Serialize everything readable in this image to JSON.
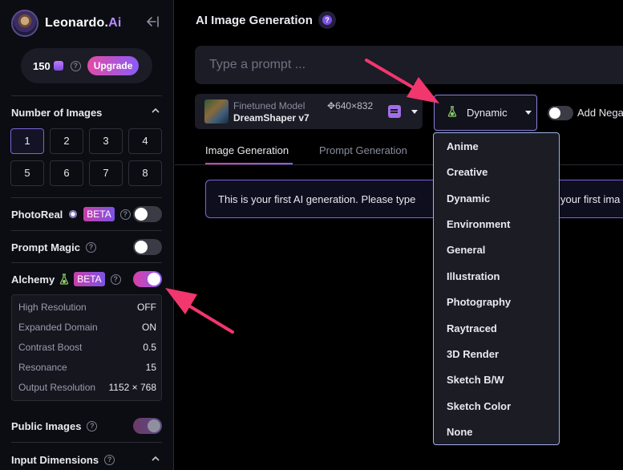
{
  "brand": {
    "name_prefix": "Leonardo.",
    "name_suffix": "Ai"
  },
  "credits": {
    "amount": "150",
    "upgrade_label": "Upgrade"
  },
  "number_of_images": {
    "title": "Number of Images",
    "options": [
      "1",
      "2",
      "3",
      "4",
      "5",
      "6",
      "7",
      "8"
    ],
    "selected": "1"
  },
  "photoreal": {
    "label": "PhotoReal",
    "badge": "BETA",
    "enabled": false
  },
  "prompt_magic": {
    "label": "Prompt Magic",
    "enabled": false
  },
  "alchemy": {
    "label": "Alchemy",
    "badge": "BETA",
    "enabled": true,
    "settings": [
      {
        "label": "High Resolution",
        "value": "OFF"
      },
      {
        "label": "Expanded Domain",
        "value": "ON"
      },
      {
        "label": "Contrast Boost",
        "value": "0.5"
      },
      {
        "label": "Resonance",
        "value": "15"
      },
      {
        "label": "Output Resolution",
        "value": "1152 × 768"
      }
    ]
  },
  "public_images": {
    "label": "Public Images",
    "enabled": true
  },
  "input_dimensions": {
    "label": "Input Dimensions"
  },
  "main": {
    "title": "AI Image Generation",
    "prompt_placeholder": "Type a prompt ...",
    "model": {
      "subtitle": "Finetuned Model",
      "name": "DreamShaper v7",
      "dimensions": "640×832"
    },
    "style": {
      "selected": "Dynamic"
    },
    "negative_prompt_label": "Add Nega",
    "tabs": [
      "Image Generation",
      "Prompt Generation"
    ],
    "notice_start": "This is your first AI generation. Please type",
    "notice_end": "your first ima"
  },
  "style_options": [
    "Anime",
    "Creative",
    "Dynamic",
    "Environment",
    "General",
    "Illustration",
    "Photography",
    "Raytraced",
    "3D Render",
    "Sketch B/W",
    "Sketch Color",
    "None"
  ],
  "colors": {
    "accent_pink": "#e24ba6",
    "accent_purple": "#8a5cf6",
    "arrow": "#f2366e",
    "background": "#000000",
    "sidebar": "#0c0d12"
  },
  "icons": [
    "collapse-sidebar-icon",
    "coin-icon",
    "help-icon",
    "chevron-up-icon",
    "photoreal-icon",
    "alchemy-flask-icon",
    "prompt-help-icon",
    "notes-icon",
    "caret-down-icon",
    "annotation-arrow"
  ]
}
